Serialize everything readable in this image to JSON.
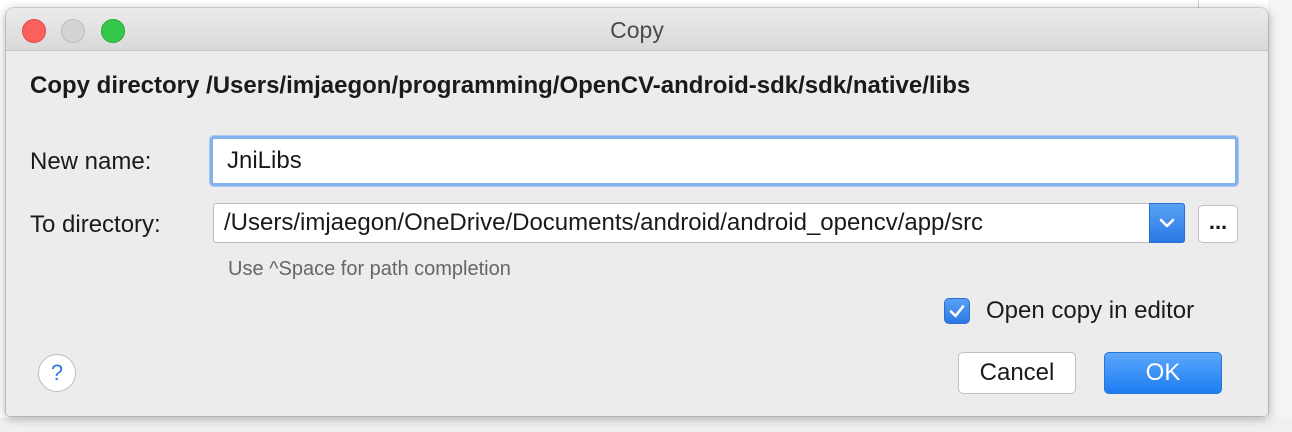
{
  "window": {
    "title": "Copy",
    "controls": [
      "close",
      "minimize",
      "zoom"
    ]
  },
  "dialog": {
    "heading": "Copy directory /Users/imjaegon/programming/OpenCV-android-sdk/sdk/native/libs",
    "new_name": {
      "label": "New name:",
      "value": "JniLibs"
    },
    "to_directory": {
      "label": "To directory:",
      "value": "/Users/imjaegon/OneDrive/Documents/android/android_opencv/app/src",
      "browse_label": "...",
      "dropdown_icon": "chevron-down-icon"
    },
    "hint": "Use ^Space for path completion",
    "open_in_editor": {
      "label": "Open copy in editor",
      "checked": true
    },
    "help_label": "?",
    "cancel_label": "Cancel",
    "ok_label": "OK"
  },
  "colors": {
    "accent": "#2a78e4",
    "focus_ring": "#82b1ec",
    "window_bg": "#ececec"
  }
}
